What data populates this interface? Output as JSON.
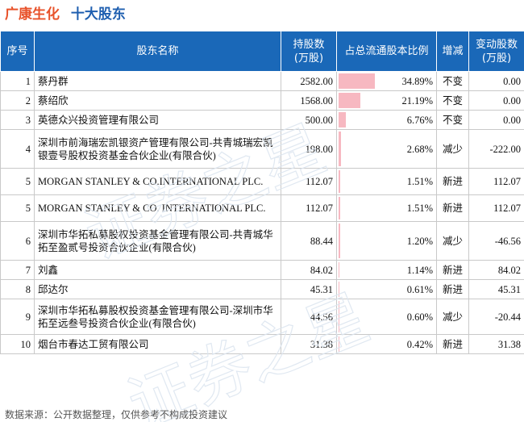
{
  "title": {
    "company": "广康生化",
    "subtitle": "十大股东"
  },
  "table": {
    "headers": {
      "index": "序号",
      "name": "股东名称",
      "shares_l1": "持股数",
      "shares_l2": "(万股)",
      "ratio": "占总流通股本比例",
      "change": "增减",
      "delta_l1": "变动股数",
      "delta_l2": "(万股)"
    },
    "rows": [
      {
        "idx": "1",
        "name": "蔡丹群",
        "shares": "2582.00",
        "ratio": "34.89%",
        "ratio_value": 34.89,
        "change": "不变",
        "change_type": "same",
        "delta": "0.00"
      },
      {
        "idx": "2",
        "name": "蔡绍欣",
        "shares": "1568.00",
        "ratio": "21.19%",
        "ratio_value": 21.19,
        "change": "不变",
        "change_type": "same",
        "delta": "0.00"
      },
      {
        "idx": "3",
        "name": "英德众兴投资管理有限公司",
        "shares": "500.00",
        "ratio": "6.76%",
        "ratio_value": 6.76,
        "change": "不变",
        "change_type": "same",
        "delta": "0.00"
      },
      {
        "idx": "4",
        "name": "深圳市前海瑞宏凯银资产管理有限公司-共青城瑞宏凯银壹号股权投资基金合伙企业(有限合伙)",
        "shares": "198.00",
        "ratio": "2.68%",
        "ratio_value": 2.68,
        "change": "减少",
        "change_type": "down",
        "delta": "-222.00"
      },
      {
        "idx": "5",
        "name": "MORGAN STANLEY & CO.INTERNATIONAL PLC.",
        "shares": "112.07",
        "ratio": "1.51%",
        "ratio_value": 1.51,
        "change": "新进",
        "change_type": "new",
        "delta": "112.07"
      },
      {
        "idx": "5",
        "name": "MORGAN STANLEY & CO. INTERNATIONAL PLC.",
        "shares": "112.07",
        "ratio": "1.51%",
        "ratio_value": 1.51,
        "change": "新进",
        "change_type": "new",
        "delta": "112.07"
      },
      {
        "idx": "6",
        "name": "深圳市华拓私募股权投资基金管理有限公司-共青城华拓至盈贰号投资合伙企业(有限合伙)",
        "shares": "88.44",
        "ratio": "1.20%",
        "ratio_value": 1.2,
        "change": "减少",
        "change_type": "down",
        "delta": "-46.56"
      },
      {
        "idx": "7",
        "name": "刘鑫",
        "shares": "84.02",
        "ratio": "1.14%",
        "ratio_value": 1.14,
        "change": "新进",
        "change_type": "new",
        "delta": "84.02"
      },
      {
        "idx": "8",
        "name": "邱达尔",
        "shares": "45.31",
        "ratio": "0.61%",
        "ratio_value": 0.61,
        "change": "新进",
        "change_type": "new",
        "delta": "45.31"
      },
      {
        "idx": "9",
        "name": "深圳市华拓私募股权投资基金管理有限公司-深圳市华拓至远叁号投资合伙企业(有限合伙)",
        "shares": "44.56",
        "ratio": "0.60%",
        "ratio_value": 0.6,
        "change": "减少",
        "change_type": "down",
        "delta": "-20.44"
      },
      {
        "idx": "10",
        "name": "烟台市春达工贸有限公司",
        "shares": "31.38",
        "ratio": "0.42%",
        "ratio_value": 0.42,
        "change": "新进",
        "change_type": "new",
        "delta": "31.38"
      }
    ]
  },
  "watermark": "证券之星",
  "source": "数据来源：公开数据整理，仅供参考不构成投资建议",
  "colors": {
    "header_bg": "#1a68b8",
    "company_title": "#e8522a",
    "subtitle": "#1f5fb0",
    "bar_fill": "#f7b8c1",
    "increase": "#d42020",
    "decrease": "#2e9a3a"
  }
}
